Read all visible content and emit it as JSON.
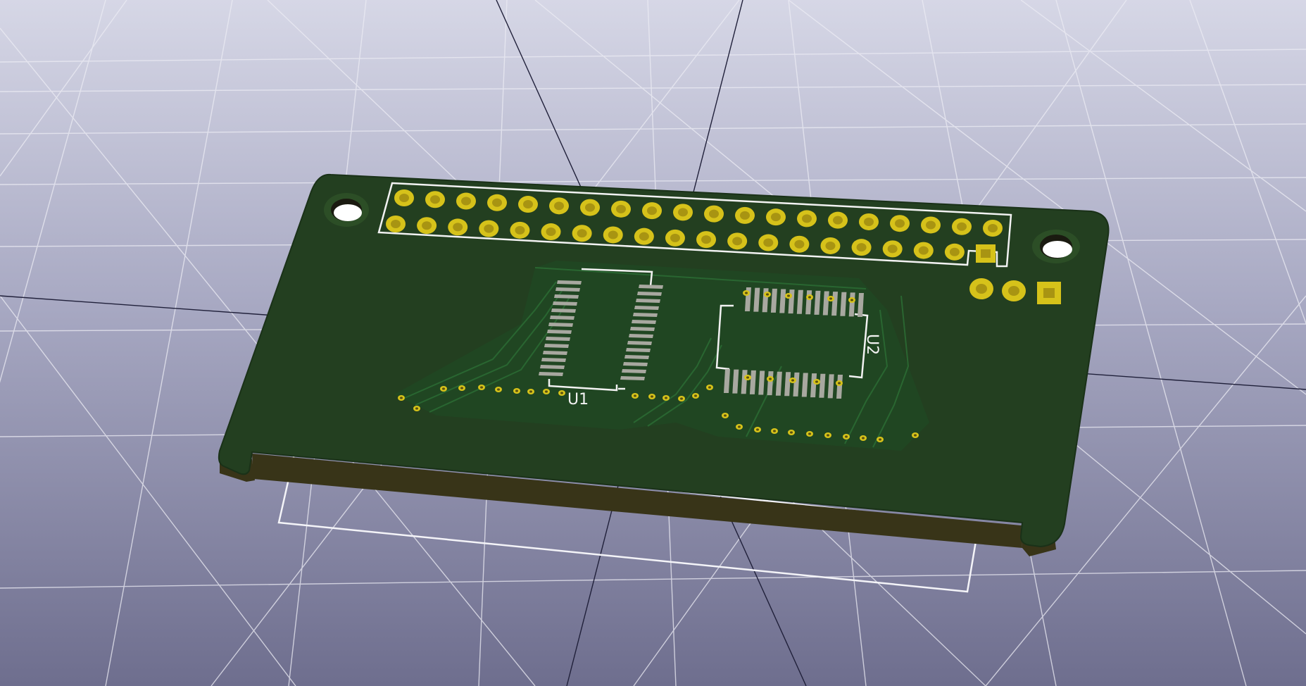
{
  "viewer": {
    "title": "",
    "board": {
      "refs": {
        "u1": "U1",
        "u2": "U2"
      },
      "header_pins_per_row": 20,
      "header_rows": 2,
      "u1_pins_per_side": 14,
      "u2_pins_per_side": 14
    },
    "colors": {
      "background_top": "#d6d7e6",
      "background_bottom": "#6e6e8e",
      "grid": "#ececf4",
      "board_top": "#233f20",
      "board_edge": "#383418",
      "copper_trace": "#1e5a2c",
      "pad_gold": "#d6c21a",
      "smd_pad": "#a8a8a0",
      "silkscreen": "#f2f2f2"
    }
  }
}
